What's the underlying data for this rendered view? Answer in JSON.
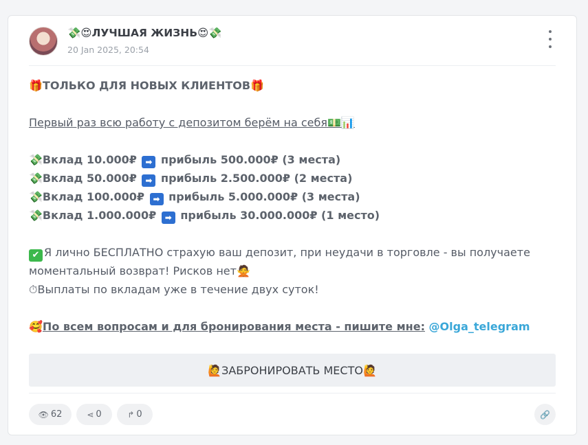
{
  "post": {
    "channel_name": "💸😍ЛУЧШАЯ ЖИЗНЬ😍💸",
    "date": "20 Jan 2025, 20:54",
    "lines": {
      "headline": "🎁ТОЛЬКО ДЛЯ НОВЫХ КЛИЕНТОВ🎁",
      "intro": "Первый раз всю работу с депозитом берём на себя💵📊",
      "offers": [
        {
          "left": "💸Вклад 10.000₽",
          "arrow": "➡",
          "right": "прибыль 500.000₽ (3 места)"
        },
        {
          "left": "💸Вклад 50.000₽",
          "arrow": "➡",
          "right": "прибыль 2.500.000₽ (2 места)"
        },
        {
          "left": "💸Вклад 100.000₽",
          "arrow": "➡",
          "right": "прибыль 5.000.000₽ (3 места)"
        },
        {
          "left": "💸Вклад 1.000.000₽",
          "arrow": "➡",
          "right": "прибыль 30.000.000₽ (1 место)"
        }
      ],
      "guarantee_check": "✔",
      "guarantee_1": "Я лично БЕСПЛАТНО страхую ваш депозит, при неудачи в торговле - вы получаете",
      "guarantee_2": "моментальный возврат! Рисков нет🙅",
      "payouts": "⏱Выплаты по вкладам уже в течение двух суток!",
      "contact_emoji": "🥰",
      "contact_text": "По всем вопросам и для бронирования места - пишите мне:",
      "contact_handle": "@Olga_telegram"
    },
    "button_label": "🙋ЗАБРОНИРОВАТЬ МЕСТО🙋"
  },
  "stats": {
    "views": "62",
    "shares": "0",
    "forwards": "0",
    "icons": {
      "views": "eye-icon",
      "shares": "share-icon",
      "forwards": "forward-icon",
      "link": "link-icon",
      "menu": "more-vertical-icon"
    }
  },
  "colors": {
    "handle": "#3aa7d8",
    "button_bg": "#eef0f3",
    "pill_bg": "#f0f1f3"
  }
}
